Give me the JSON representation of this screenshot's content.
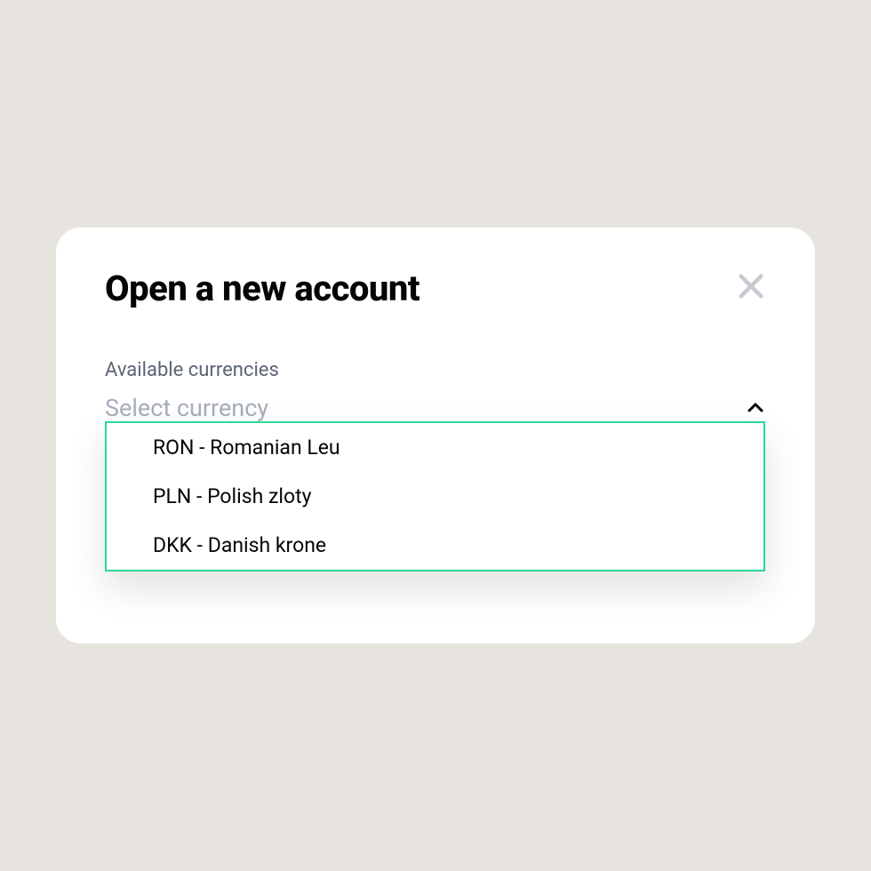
{
  "modal": {
    "title": "Open a new account"
  },
  "field": {
    "label": "Available currencies",
    "placeholder": "Select currency"
  },
  "options": [
    "RON - Romanian Leu",
    "PLN - Polish zloty",
    "DKK - Danish krone"
  ]
}
